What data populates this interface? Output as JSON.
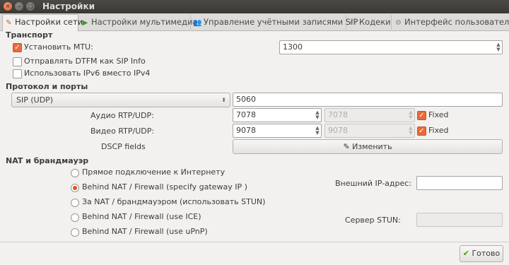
{
  "window": {
    "title": "Настройки"
  },
  "tabs": [
    {
      "label": "Настройки сети",
      "icon": "network-settings-icon",
      "glyph": "✎",
      "active": true
    },
    {
      "label": "Настройки мультимедиа",
      "icon": "play-icon",
      "glyph": "▶",
      "active": false
    },
    {
      "label": "Управление учётными записями SIP",
      "icon": "accounts-icon",
      "glyph": "👥",
      "active": false
    },
    {
      "label": "Кодеки",
      "icon": "codecs-icon",
      "glyph": "☊",
      "active": false
    },
    {
      "label": "Интерфейс пользователя",
      "icon": "gear-icon",
      "glyph": "⚙",
      "active": false
    }
  ],
  "transport": {
    "heading": "Транспорт",
    "mtu_label": "Установить MTU:",
    "mtu_checked": true,
    "mtu_value": "1300",
    "dtmf_label": "Отправлять DTFM как SIP Info",
    "dtmf_checked": false,
    "ipv6_label": "Использовать IPv6 вместо IPv4",
    "ipv6_checked": false
  },
  "protocol": {
    "heading": "Протокол и порты",
    "protocol_value": "SIP (UDP)",
    "port_value": "5060",
    "audio_label": "Аудио RTP/UDP:",
    "audio_port": "7078",
    "audio_port_max": "7078",
    "audio_fixed_label": "Fixed",
    "audio_fixed_checked": true,
    "video_label": "Видео RTP/UDP:",
    "video_port": "9078",
    "video_port_max": "9078",
    "video_fixed_label": "Fixed",
    "video_fixed_checked": true,
    "dscp_label": "DSCP fields",
    "dscp_button": "Изменить"
  },
  "nat": {
    "heading": "NAT и брандмауэр",
    "options": [
      {
        "label": "Прямое подключение к Интернету",
        "checked": false
      },
      {
        "label": "Behind NAT / Firewall (specify gateway IP )",
        "checked": true
      },
      {
        "label": "За NAT / брандмауэром (использовать STUN)",
        "checked": false
      },
      {
        "label": "Behind NAT / Firewall (use ICE)",
        "checked": false
      },
      {
        "label": "Behind NAT / Firewall (use uPnP)",
        "checked": false
      }
    ],
    "external_ip_label": "Внешний IP-адрес:",
    "external_ip_value": "",
    "stun_label": "Сервер STUN:",
    "stun_value": ""
  },
  "footer": {
    "done_button": "Готово"
  }
}
